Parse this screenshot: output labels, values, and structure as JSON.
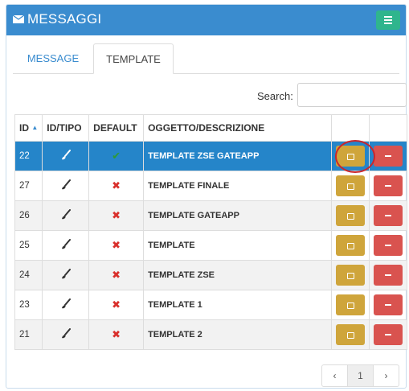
{
  "header": {
    "title": "MESSAGGI",
    "envelope_icon": "envelope-icon",
    "menu_icon": "hamburger-icon"
  },
  "tabs": [
    {
      "label": "MESSAGE",
      "active": false
    },
    {
      "label": "TEMPLATE",
      "active": true
    }
  ],
  "search": {
    "label": "Search:",
    "value": ""
  },
  "table": {
    "columns": [
      "ID",
      "ID/TIPO",
      "DEFAULT",
      "OGGETTO/DESCRIZIONE"
    ],
    "sort_indicator": "▲",
    "rows": [
      {
        "id": "22",
        "tipo_icon": "brush-icon",
        "default": "✔",
        "descrizione": "TEMPLATE ZSE GATEAPP",
        "selected": true
      },
      {
        "id": "27",
        "tipo_icon": "brush-icon",
        "default": "✖",
        "descrizione": "TEMPLATE FINALE"
      },
      {
        "id": "26",
        "tipo_icon": "brush-icon",
        "default": "✖",
        "descrizione": "TEMPLATE GATEAPP"
      },
      {
        "id": "25",
        "tipo_icon": "brush-icon",
        "default": "✖",
        "descrizione": "TEMPLATE"
      },
      {
        "id": "24",
        "tipo_icon": "brush-icon",
        "default": "✖",
        "descrizione": "TEMPLATE ZSE"
      },
      {
        "id": "23",
        "tipo_icon": "brush-icon",
        "default": "✖",
        "descrizione": "TEMPLATE 1"
      },
      {
        "id": "21",
        "tipo_icon": "brush-icon",
        "default": "✖",
        "descrizione": "TEMPLATE 2"
      }
    ]
  },
  "pagination": {
    "prev": "‹",
    "current": "1",
    "next": "›"
  },
  "colors": {
    "header": "#3a8ccf",
    "menu_button": "#2fb58d",
    "selected_row": "#2585c9",
    "edit_button": "#cfa53b",
    "delete_button": "#d9534f",
    "highlight_ring": "#c9262c"
  }
}
